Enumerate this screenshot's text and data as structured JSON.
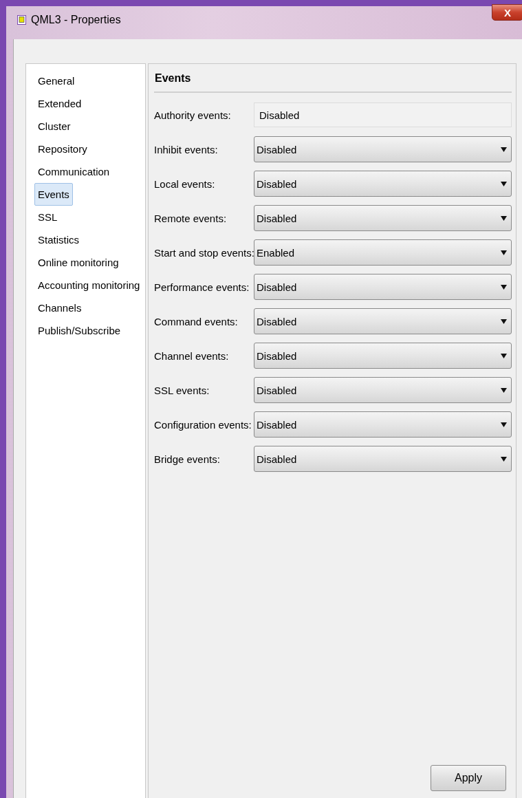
{
  "window": {
    "title": "QML3 - Properties",
    "close_label": "X"
  },
  "sidebar": {
    "items": [
      {
        "label": "General",
        "selected": false
      },
      {
        "label": "Extended",
        "selected": false
      },
      {
        "label": "Cluster",
        "selected": false
      },
      {
        "label": "Repository",
        "selected": false
      },
      {
        "label": "Communication",
        "selected": false
      },
      {
        "label": "Events",
        "selected": true
      },
      {
        "label": "SSL",
        "selected": false
      },
      {
        "label": "Statistics",
        "selected": false
      },
      {
        "label": "Online monitoring",
        "selected": false
      },
      {
        "label": "Accounting monitoring",
        "selected": false
      },
      {
        "label": "Channels",
        "selected": false
      },
      {
        "label": "Publish/Subscribe",
        "selected": false
      }
    ]
  },
  "panel": {
    "heading": "Events",
    "fields": [
      {
        "label": "Authority events:",
        "kind": "readonly",
        "value": "Disabled"
      },
      {
        "label": "Inhibit events:",
        "kind": "dropdown",
        "value": "Disabled"
      },
      {
        "label": "Local events:",
        "kind": "dropdown",
        "value": "Disabled"
      },
      {
        "label": "Remote events:",
        "kind": "dropdown",
        "value": "Disabled"
      },
      {
        "label": "Start and stop events:",
        "kind": "dropdown",
        "value": "Enabled"
      },
      {
        "label": "Performance events:",
        "kind": "dropdown",
        "value": "Disabled"
      },
      {
        "label": "Command events:",
        "kind": "dropdown",
        "value": "Disabled"
      },
      {
        "label": "Channel events:",
        "kind": "dropdown",
        "value": "Disabled"
      },
      {
        "label": "SSL events:",
        "kind": "dropdown",
        "value": "Disabled"
      },
      {
        "label": "Configuration events:",
        "kind": "dropdown",
        "value": "Disabled"
      },
      {
        "label": "Bridge events:",
        "kind": "dropdown",
        "value": "Disabled"
      }
    ],
    "apply_button": "Apply"
  }
}
